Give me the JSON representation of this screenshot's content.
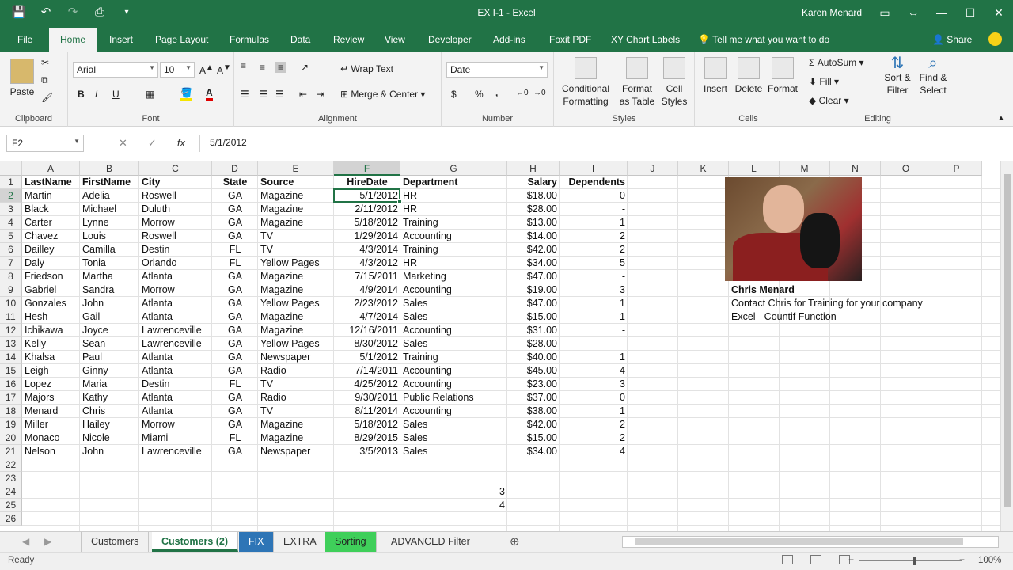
{
  "window": {
    "title": "EX I-1  -  Excel",
    "user": "Karen Menard",
    "controls": [
      "▭",
      "⇔",
      "—",
      "☐",
      "✕"
    ]
  },
  "qat": [
    "💾",
    "↶",
    "↷",
    "⎙",
    "▾"
  ],
  "ribbon_tabs": [
    "File",
    "Home",
    "Insert",
    "Page Layout",
    "Formulas",
    "Data",
    "Review",
    "View",
    "Developer",
    "Add-ins",
    "Foxit PDF",
    "XY Chart Labels"
  ],
  "tell_me": "Tell me what you want to do",
  "share": "Share",
  "ribbon": {
    "clipboard": {
      "label": "Clipboard",
      "paste": "Paste"
    },
    "font": {
      "label": "Font",
      "name": "Arial",
      "size": "10",
      "bold": "B",
      "italic": "I",
      "underline": "U"
    },
    "alignment": {
      "label": "Alignment",
      "wrap": "Wrap Text",
      "merge": "Merge & Center"
    },
    "number": {
      "label": "Number",
      "format": "Date",
      "currency": "$",
      "percent": "%",
      "comma": ","
    },
    "styles": {
      "label": "Styles",
      "cond": "Conditional Formatting",
      "table": "Format as Table",
      "cell": "Cell Styles"
    },
    "cells": {
      "label": "Cells",
      "insert": "Insert",
      "delete": "Delete",
      "format": "Format"
    },
    "editing": {
      "label": "Editing",
      "autosum": "AutoSum",
      "fill": "Fill",
      "clear": "Clear",
      "sort": "Sort & Filter",
      "find": "Find & Select"
    }
  },
  "formula_bar": {
    "name_box": "F2",
    "value": "5/1/2012"
  },
  "columns": [
    "A",
    "B",
    "C",
    "D",
    "E",
    "F",
    "G",
    "H",
    "I",
    "J",
    "K",
    "L",
    "M",
    "N",
    "O",
    "P"
  ],
  "headers": [
    "LastName",
    "FirstName",
    "City",
    "State",
    "Source",
    "HireDate",
    "Department",
    "Salary",
    "Dependents"
  ],
  "rows": [
    [
      "Martin",
      "Adelia",
      "Roswell",
      "GA",
      "Magazine",
      "5/1/2012",
      "HR",
      "$18.00",
      "0"
    ],
    [
      "Black",
      "Michael",
      "Duluth",
      "GA",
      "Magazine",
      "2/11/2012",
      "HR",
      "$28.00",
      "-"
    ],
    [
      "Carter",
      "Lynne",
      "Morrow",
      "GA",
      "Magazine",
      "5/18/2012",
      "Training",
      "$13.00",
      "1"
    ],
    [
      "Chavez",
      "Louis",
      "Roswell",
      "GA",
      "TV",
      "1/29/2014",
      "Accounting",
      "$14.00",
      "2"
    ],
    [
      "Dailley",
      "Camilla",
      "Destin",
      "FL",
      "TV",
      "4/3/2014",
      "Training",
      "$42.00",
      "2"
    ],
    [
      "Daly",
      "Tonia",
      "Orlando",
      "FL",
      "Yellow Pages",
      "4/3/2012",
      "HR",
      "$34.00",
      "5"
    ],
    [
      "Friedson",
      "Martha",
      "Atlanta",
      "GA",
      "Magazine",
      "7/15/2011",
      "Marketing",
      "$47.00",
      "-"
    ],
    [
      "Gabriel",
      "Sandra",
      "Morrow",
      "GA",
      "Magazine",
      "4/9/2014",
      "Accounting",
      "$19.00",
      "3"
    ],
    [
      "Gonzales",
      "John",
      "Atlanta",
      "GA",
      "Yellow Pages",
      "2/23/2012",
      "Sales",
      "$47.00",
      "1"
    ],
    [
      "Hesh",
      "Gail",
      "Atlanta",
      "GA",
      "Magazine",
      "4/7/2014",
      "Sales",
      "$15.00",
      "1"
    ],
    [
      "Ichikawa",
      "Joyce",
      "Lawrenceville",
      "GA",
      "Magazine",
      "12/16/2011",
      "Accounting",
      "$31.00",
      "-"
    ],
    [
      "Kelly",
      "Sean",
      "Lawrenceville",
      "GA",
      "Yellow Pages",
      "8/30/2012",
      "Sales",
      "$28.00",
      "-"
    ],
    [
      "Khalsa",
      "Paul",
      "Atlanta",
      "GA",
      "Newspaper",
      "5/1/2012",
      "Training",
      "$40.00",
      "1"
    ],
    [
      "Leigh",
      "Ginny",
      "Atlanta",
      "GA",
      "Radio",
      "7/14/2011",
      "Accounting",
      "$45.00",
      "4"
    ],
    [
      "Lopez",
      "Maria",
      "Destin",
      "FL",
      "TV",
      "4/25/2012",
      "Accounting",
      "$23.00",
      "3"
    ],
    [
      "Majors",
      "Kathy",
      "Atlanta",
      "GA",
      "Radio",
      "9/30/2011",
      "Public Relations",
      "$37.00",
      "0"
    ],
    [
      "Menard",
      "Chris",
      "Atlanta",
      "GA",
      "TV",
      "8/11/2014",
      "Accounting",
      "$38.00",
      "1"
    ],
    [
      "Miller",
      "Hailey",
      "Morrow",
      "GA",
      "Magazine",
      "5/18/2012",
      "Sales",
      "$42.00",
      "2"
    ],
    [
      "Monaco",
      "Nicole",
      "Miami",
      "FL",
      "Magazine",
      "8/29/2015",
      "Sales",
      "$15.00",
      "2"
    ],
    [
      "Nelson",
      "John",
      "Lawrenceville",
      "GA",
      "Newspaper",
      "3/5/2013",
      "Sales",
      "$34.00",
      "4"
    ]
  ],
  "extra_cells": {
    "g24": "3",
    "g25": "4"
  },
  "side_note": {
    "name": "Chris Menard",
    "line1": "Contact Chris for Training for your company",
    "line2": "Excel - Countif Function"
  },
  "row_numbers": [
    "1",
    "2",
    "3",
    "4",
    "5",
    "6",
    "7",
    "8",
    "9",
    "10",
    "11",
    "12",
    "13",
    "14",
    "15",
    "16",
    "17",
    "18",
    "19",
    "20",
    "21",
    "22",
    "23",
    "24",
    "25",
    "26"
  ],
  "sheet_tabs": [
    "Customers",
    "Customers (2)",
    "FIX",
    "EXTRA",
    "Sorting",
    "ADVANCED Filter"
  ],
  "status": {
    "ready": "Ready",
    "zoom": "100%"
  }
}
